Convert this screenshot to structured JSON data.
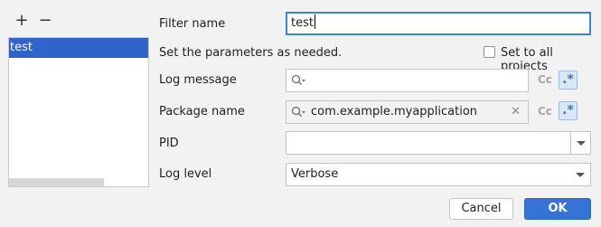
{
  "left_panel": {
    "add_label": "+",
    "remove_label": "−",
    "filters": [
      {
        "label": "test",
        "selected": true
      }
    ]
  },
  "form": {
    "filter_name_label": "Filter name",
    "filter_name_value": "test",
    "hint": "Set the parameters as needed.",
    "set_all_label": "Set to all projects",
    "log_message_label": "Log message",
    "log_message_value": "",
    "package_name_label": "Package name",
    "package_name_value": "com.example.myapplication",
    "pid_label": "PID",
    "pid_value": "",
    "log_level_label": "Log level",
    "log_level_value": "Verbose",
    "match_case_label": "Cc",
    "regex_label": ".*"
  },
  "buttons": {
    "cancel": "Cancel",
    "ok": "OK"
  },
  "colors": {
    "accent": "#3574d4",
    "selection": "#2f65ca",
    "focus_border": "#3c82d6"
  }
}
